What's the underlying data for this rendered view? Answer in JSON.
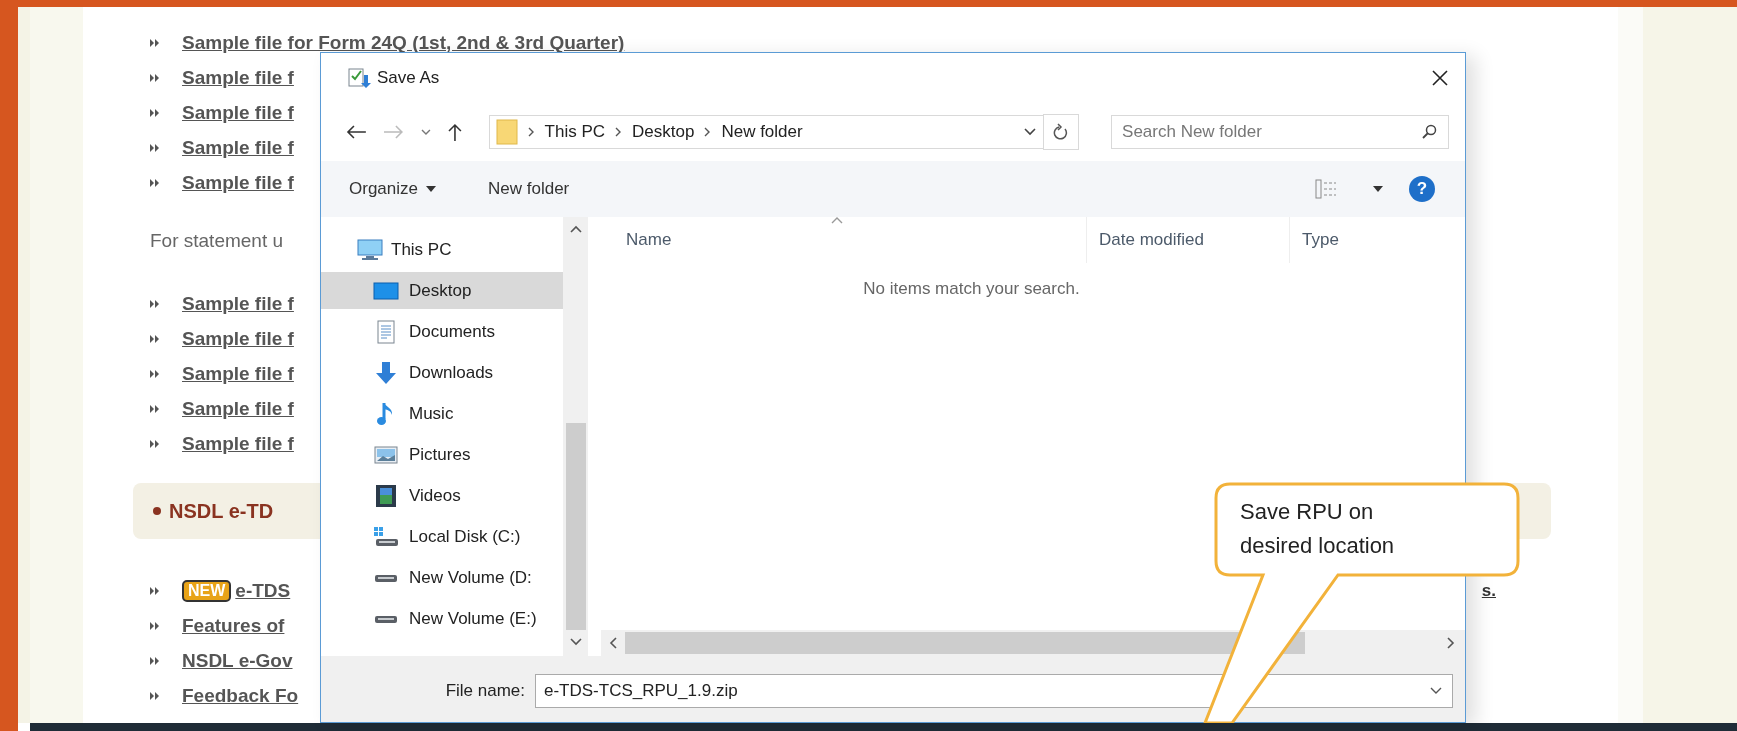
{
  "page": {
    "links_top": [
      "Sample file for Form 24Q (1st, 2nd & 3rd Quarter)",
      "Sample file f",
      "Sample file f",
      "Sample file f",
      "Sample file f"
    ],
    "note": "For statement u",
    "links_mid": [
      "Sample file f",
      "Sample file f",
      "Sample file f",
      "Sample file f",
      "Sample file f"
    ],
    "section_title": "NSDL e-TD",
    "links_bottom": [
      {
        "badge": "NEW",
        "text": "e-TDS"
      },
      {
        "text": "Features of"
      },
      {
        "text": "NSDL e-Gov"
      },
      {
        "text": "Feedback Fo"
      }
    ],
    "cut_text": "s."
  },
  "dialog": {
    "title": "Save As",
    "path": [
      "This PC",
      "Desktop",
      "New folder"
    ],
    "search": {
      "placeholder": "Search New folder"
    },
    "toolbar": [
      {
        "label": "Organize",
        "menu": true
      },
      {
        "label": "New folder",
        "menu": false
      }
    ],
    "help": "?",
    "nav": [
      {
        "label": "This PC",
        "kind": "pc",
        "selected": false,
        "children": [
          {
            "label": "Desktop",
            "kind": "desktop",
            "selected": true
          },
          {
            "label": "Documents",
            "kind": "documents",
            "selected": false
          },
          {
            "label": "Downloads",
            "kind": "downloads",
            "selected": false
          },
          {
            "label": "Music",
            "kind": "music",
            "selected": false
          },
          {
            "label": "Pictures",
            "kind": "pictures",
            "selected": false
          },
          {
            "label": "Videos",
            "kind": "videos",
            "selected": false
          },
          {
            "label": "Local Disk (C:)",
            "kind": "system_drive",
            "selected": false
          },
          {
            "label": "New Volume (D:",
            "kind": "drive",
            "selected": false
          },
          {
            "label": "New Volume (E:)",
            "kind": "drive",
            "selected": false
          }
        ]
      }
    ],
    "columns": [
      {
        "label": "Name",
        "sorted": true
      },
      {
        "label": "Date modified",
        "sorted": false
      },
      {
        "label": "Type",
        "sorted": false
      }
    ],
    "empty_message": "No items match your search.",
    "file_name": {
      "label": "File name:",
      "value": "e-TDS-TCS_RPU_1.9.zip"
    }
  },
  "callout": {
    "text": "Save RPU on desired location"
  }
}
